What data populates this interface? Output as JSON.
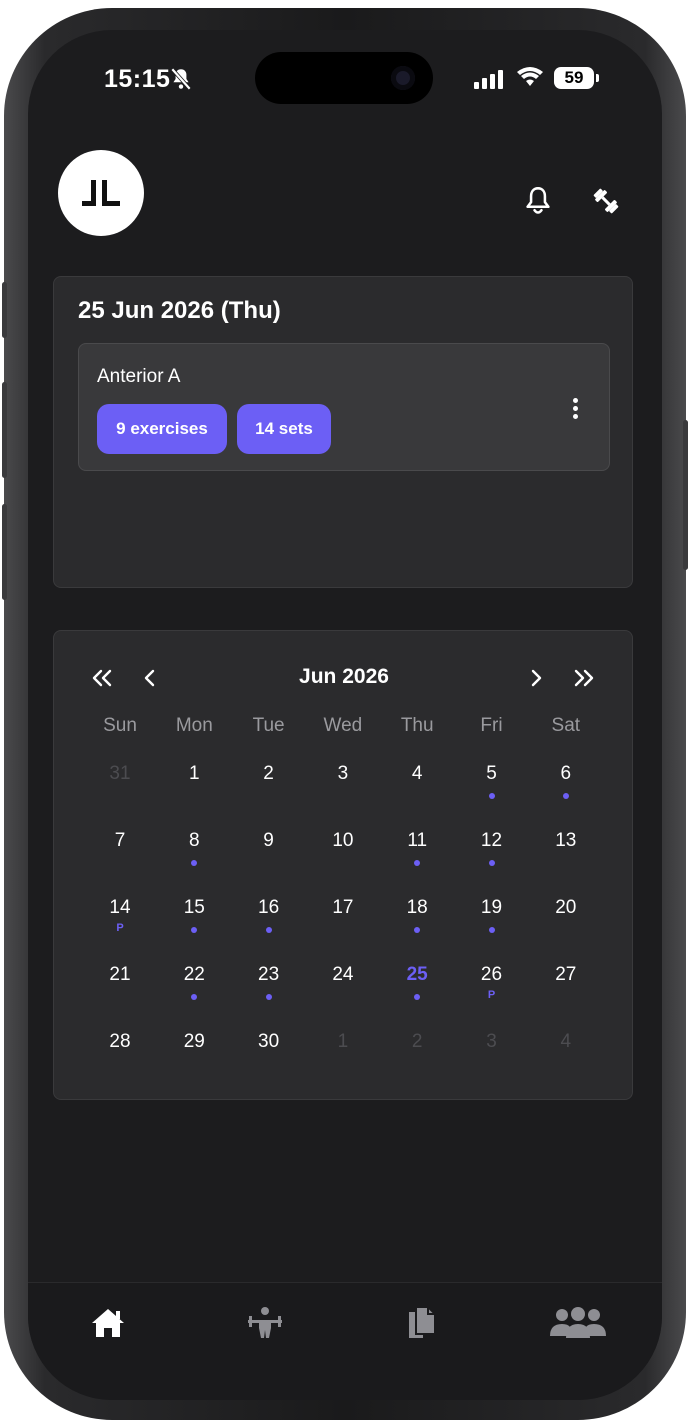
{
  "status_bar": {
    "time": "15:15",
    "battery": "59"
  },
  "header": {
    "avatar_initials": "JL"
  },
  "today": {
    "date_title": "25 Jun 2026 (Thu)",
    "workout": {
      "name": "Anterior A",
      "exercises_chip": "9 exercises",
      "sets_chip": "14 sets"
    }
  },
  "calendar": {
    "month_title": "Jun 2026",
    "weekdays": [
      "Sun",
      "Mon",
      "Tue",
      "Wed",
      "Thu",
      "Fri",
      "Sat"
    ],
    "weeks": [
      [
        {
          "n": "31",
          "muted": true
        },
        {
          "n": "1"
        },
        {
          "n": "2"
        },
        {
          "n": "3"
        },
        {
          "n": "4"
        },
        {
          "n": "5",
          "dot": true
        },
        {
          "n": "6",
          "dot": true
        }
      ],
      [
        {
          "n": "7"
        },
        {
          "n": "8",
          "dot": true
        },
        {
          "n": "9"
        },
        {
          "n": "10"
        },
        {
          "n": "11",
          "dot": true
        },
        {
          "n": "12",
          "dot": true
        },
        {
          "n": "13"
        }
      ],
      [
        {
          "n": "14",
          "mark": "P"
        },
        {
          "n": "15",
          "dot": true
        },
        {
          "n": "16",
          "dot": true
        },
        {
          "n": "17"
        },
        {
          "n": "18",
          "dot": true
        },
        {
          "n": "19",
          "dot": true
        },
        {
          "n": "20"
        }
      ],
      [
        {
          "n": "21"
        },
        {
          "n": "22",
          "dot": true
        },
        {
          "n": "23",
          "dot": true
        },
        {
          "n": "24"
        },
        {
          "n": "25",
          "dot": true,
          "today": true
        },
        {
          "n": "26",
          "mark": "P"
        },
        {
          "n": "27"
        }
      ],
      [
        {
          "n": "28"
        },
        {
          "n": "29"
        },
        {
          "n": "30"
        },
        {
          "n": "1",
          "muted": true
        },
        {
          "n": "2",
          "muted": true
        },
        {
          "n": "3",
          "muted": true
        },
        {
          "n": "4",
          "muted": true
        }
      ]
    ]
  },
  "icons": {
    "header": [
      "bell-icon",
      "dumbbell-icon"
    ],
    "tabs": [
      "home-icon",
      "weightlifter-icon",
      "documents-icon",
      "users-icon"
    ]
  },
  "colors": {
    "accent": "#6c5ff5",
    "background": "#1c1c1e",
    "card": "#2b2b2d"
  }
}
